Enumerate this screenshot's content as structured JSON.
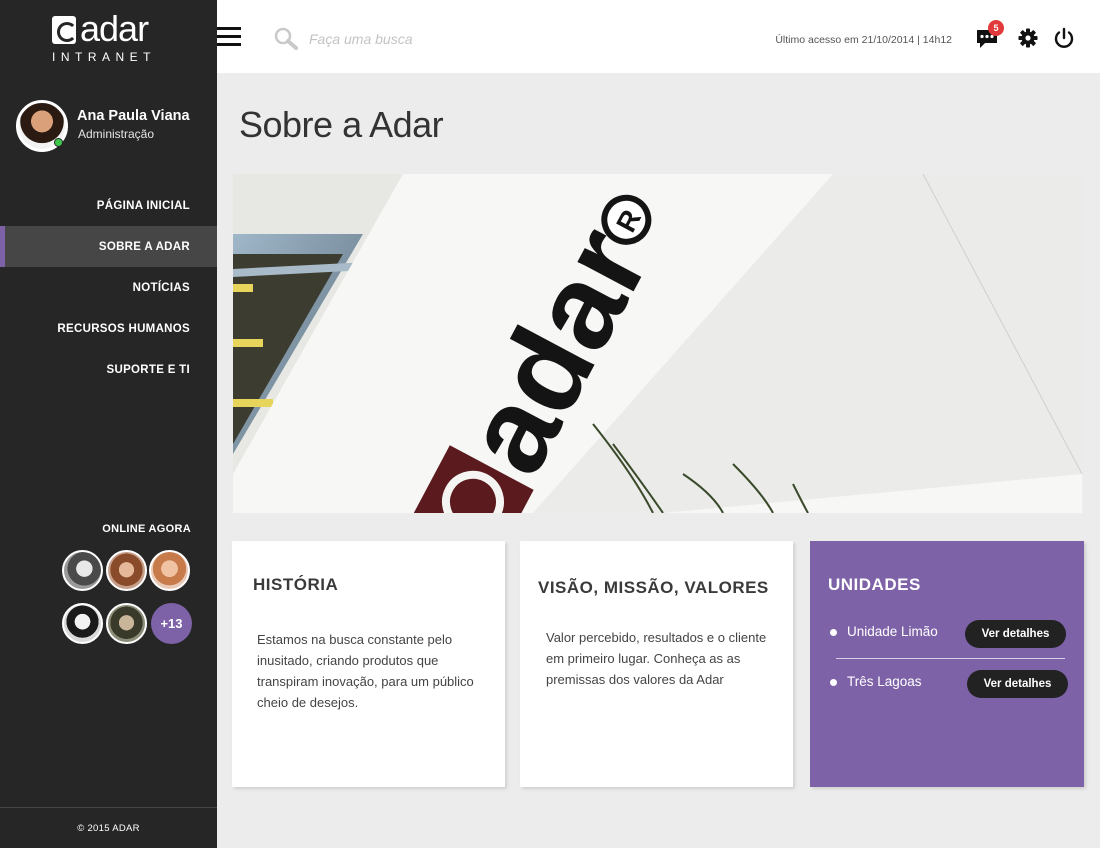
{
  "brand": {
    "name": "adar",
    "subtitle": "INTRANET"
  },
  "user": {
    "name": "Ana Paula Viana",
    "role": "Administração"
  },
  "nav": {
    "items": [
      {
        "label": "PÁGINA INICIAL",
        "active": false
      },
      {
        "label": "SOBRE A ADAR",
        "active": true
      },
      {
        "label": "NOTÍCIAS",
        "active": false
      },
      {
        "label": "RECURSOS HUMANOS",
        "active": false
      },
      {
        "label": "SUPORTE E TI",
        "active": false
      }
    ]
  },
  "online": {
    "title": "ONLINE AGORA",
    "more": "+13"
  },
  "footer": {
    "copyright": "© 2015  ADAR"
  },
  "topbar": {
    "search_placeholder": "Faça uma busca",
    "last_access": "Último acesso em 21/10/2014 | 14h12",
    "notifications_count": "5"
  },
  "page": {
    "title": "Sobre a Adar"
  },
  "cards": {
    "historia": {
      "title": "HISTÓRIA",
      "text": "Estamos na busca constante pelo inusitado, criando produtos que transpiram inovação, para um público cheio de desejos."
    },
    "visao": {
      "title": "VISÃO, MISSÃO, VALORES",
      "text": "Valor percebido, resultados e o cliente em primeiro lugar. Conheça as as premissas dos valores da Adar"
    },
    "unidades": {
      "title": "UNIDADES",
      "items": [
        {
          "name": "Unidade Limão",
          "button": "Ver detalhes"
        },
        {
          "name": "Três Lagoas",
          "button": "Ver detalhes"
        }
      ]
    }
  },
  "colors": {
    "accent": "#7e62a8",
    "sidebar": "#262626",
    "badge": "#e03a3a"
  },
  "icons": [
    "hamburger-icon",
    "search-icon",
    "chat-icon",
    "gear-icon",
    "power-icon"
  ]
}
